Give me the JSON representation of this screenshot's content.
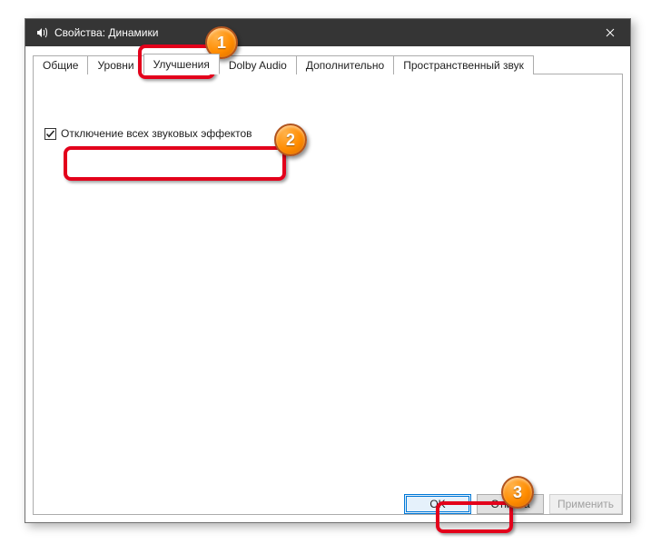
{
  "window": {
    "title": "Свойства: Динамики"
  },
  "tabs": {
    "t0": "Общие",
    "t1": "Уровни",
    "t2": "Улучшения",
    "t3": "Dolby Audio",
    "t4": "Дополнительно",
    "t5": "Пространственный звук"
  },
  "content": {
    "disable_effects_label": "Отключение всех звуковых эффектов",
    "disable_effects_checked": true
  },
  "buttons": {
    "ok": "OK",
    "cancel": "Отмена",
    "apply": "Применить"
  },
  "badges": {
    "b1": "1",
    "b2": "2",
    "b3": "3"
  }
}
